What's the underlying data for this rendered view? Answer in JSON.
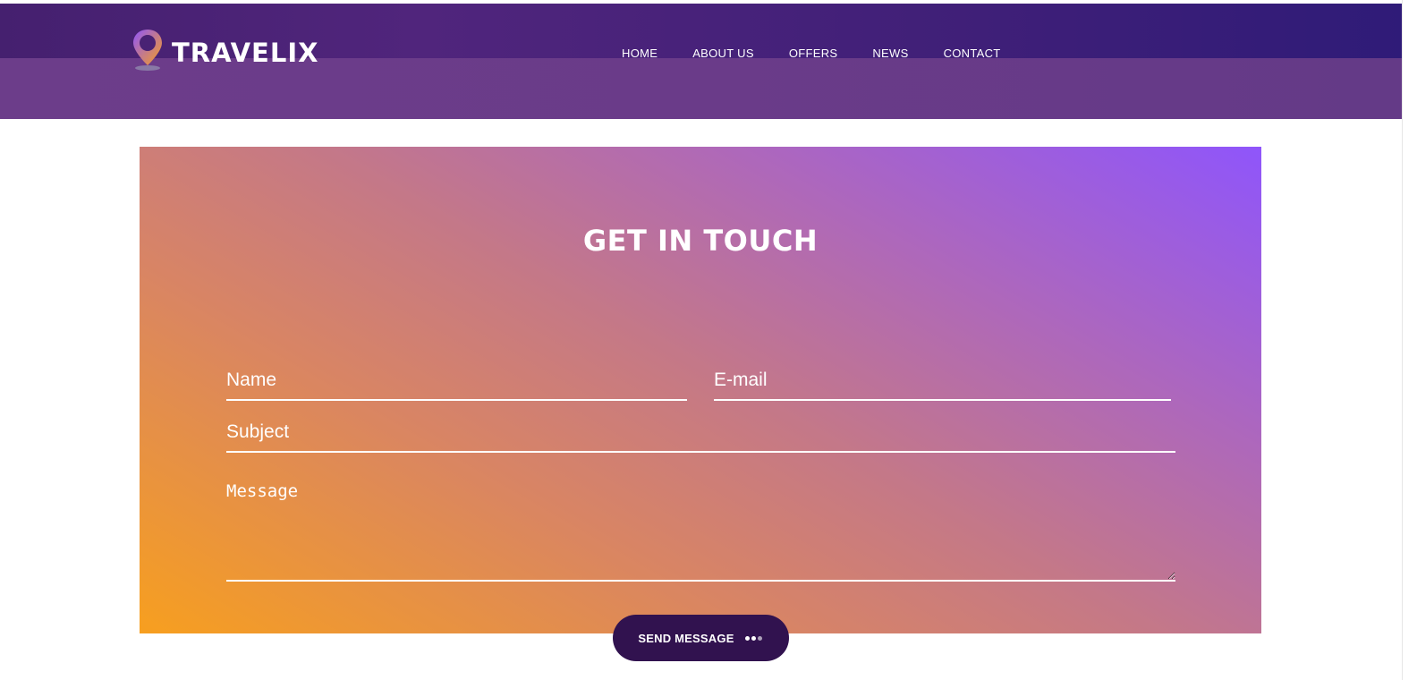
{
  "header": {
    "logo_text": "TRAVELIX",
    "logo_icon": "map-pin-icon",
    "nav": [
      {
        "label": "HOME"
      },
      {
        "label": "ABOUT US"
      },
      {
        "label": "OFFERS"
      },
      {
        "label": "NEWS"
      },
      {
        "label": "CONTACT"
      }
    ]
  },
  "contact": {
    "title": "GET IN TOUCH",
    "name_placeholder": "Name",
    "email_placeholder": "E-mail",
    "subject_placeholder": "Subject",
    "message_placeholder": "Message",
    "send_label": "SEND MESSAGE",
    "send_icon": "dots-icon"
  },
  "colors": {
    "header_purple": "#6a3a88",
    "gradient_start": "#f79f1f",
    "gradient_end": "#8f55fb",
    "button_dark": "#31124f"
  }
}
